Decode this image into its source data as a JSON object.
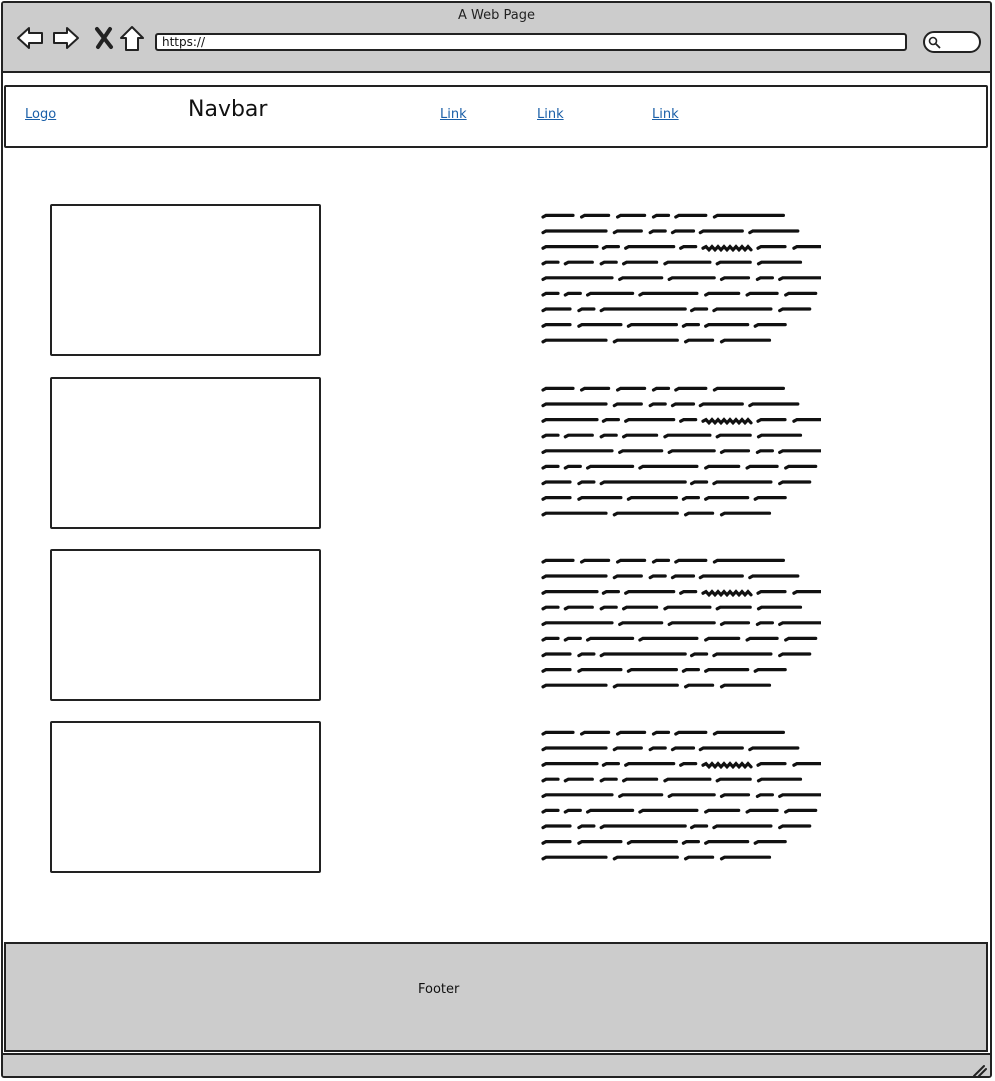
{
  "window": {
    "title": "A Web Page"
  },
  "toolbar": {
    "icons": [
      "back-arrow-icon",
      "forward-arrow-icon",
      "close-x-icon",
      "home-icon"
    ],
    "url": "https://",
    "search_icon": "search-icon"
  },
  "navbar": {
    "logo_label": "Logo",
    "title": "Navbar",
    "links": [
      "Link",
      "Link",
      "Link"
    ]
  },
  "content": {
    "rows": [
      {
        "image": "placeholder",
        "text": "scribbled placeholder text"
      },
      {
        "image": "placeholder",
        "text": "scribbled placeholder text"
      },
      {
        "image": "placeholder",
        "text": "scribbled placeholder text"
      },
      {
        "image": "placeholder",
        "text": "scribbled placeholder text"
      }
    ]
  },
  "footer": {
    "label": "Footer"
  },
  "colors": {
    "chrome": "#cccccc",
    "link": "#1a5fa8",
    "stroke": "#222222"
  }
}
